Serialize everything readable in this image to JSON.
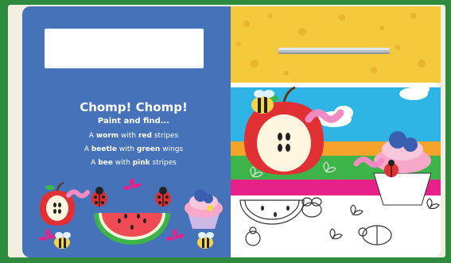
{
  "left_page": {
    "title": "Chomp! Chomp!",
    "subtitle": "Paint and find...",
    "line1": {
      "pre": "A ",
      "bold1": "worm",
      "mid": " with ",
      "bold2": "red",
      "post": " stripes"
    },
    "line2": {
      "pre": "A ",
      "bold1": "beetle",
      "mid": " with ",
      "bold2": "green",
      "post": " wings"
    },
    "line3": {
      "pre": "A ",
      "bold1": "bee",
      "mid": " with ",
      "bold2": "pink",
      "post": " stripes"
    }
  },
  "colors": {
    "frame": "#2e8a3c",
    "page_blue": "#4672b9",
    "tray_yellow": "#f4c93c",
    "sky": "#2fb4e6",
    "apple_red": "#e03034",
    "worm_pink": "#f28bc4",
    "grass_green": "#3cb44a",
    "magenta": "#e6218a"
  },
  "icons": [
    "tweezers-icon",
    "apple-icon",
    "ladybird-icon",
    "watermelon-icon",
    "cupcake-icon",
    "bee-icon",
    "worm-icon",
    "flower-icon",
    "cloud-icon"
  ]
}
